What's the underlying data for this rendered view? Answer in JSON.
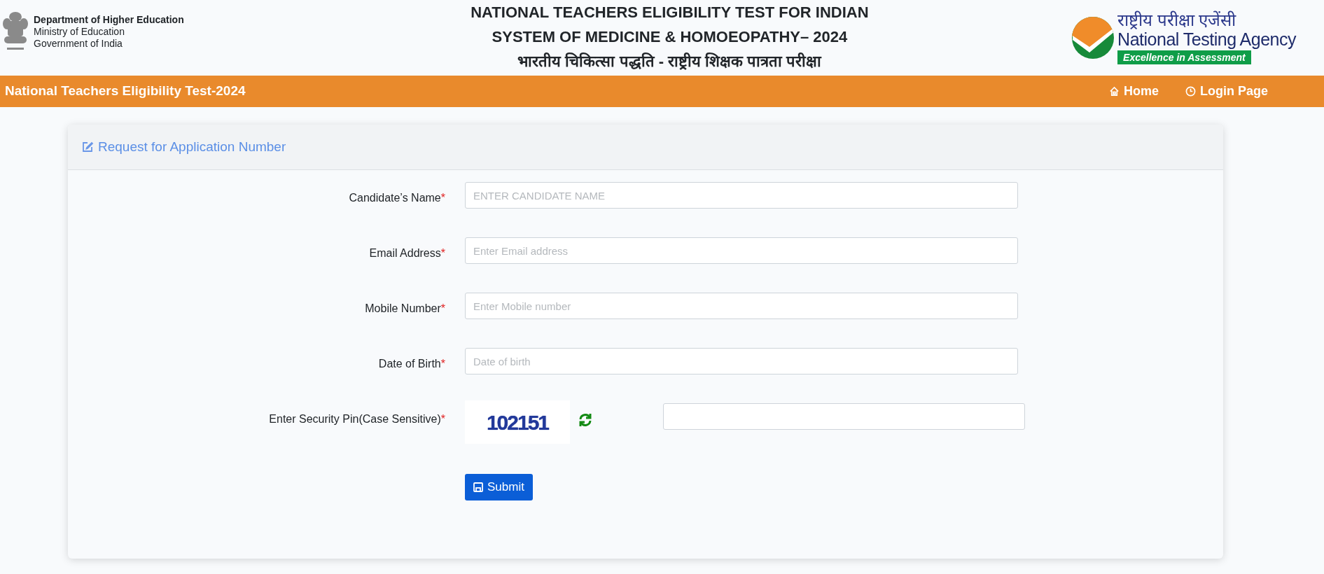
{
  "header": {
    "department": "Department of Higher Education",
    "ministry": "Ministry of Education",
    "government": "Government of India",
    "title_lines": [
      "NATIONAL TEACHERS ELIGIBILITY TEST FOR INDIAN",
      "SYSTEM OF MEDICINE & HOMOEOPATHY– 2024",
      "भारतीय चिकित्सा पद्धति - राष्ट्रीय शिक्षक पात्रता परीक्षा"
    ],
    "agency_hindi": "राष्ट्रीय परीक्षा एजेंसी",
    "agency_name": "National Testing Agency",
    "agency_tagline": "Excellence in Assessment"
  },
  "navbar": {
    "title": "National Teachers Eligibility Test-2024",
    "links": [
      {
        "label": "Home",
        "kind": "home"
      },
      {
        "label": "Login Page",
        "kind": "login"
      }
    ]
  },
  "card": {
    "title": "Request for Application Number",
    "fields": [
      {
        "label": "Candidate’s Name",
        "required_mark": "*",
        "kind": "text",
        "placeholder": "ENTER CANDIDATE NAME"
      },
      {
        "label": "Email Address",
        "required_mark": "*",
        "kind": "text",
        "placeholder": "Enter Email address"
      },
      {
        "label": "Mobile Number",
        "required_mark": "*",
        "kind": "text",
        "placeholder": "Enter Mobile number"
      },
      {
        "label": "Date of Birth",
        "required_mark": "*",
        "kind": "text",
        "placeholder": "Date of birth"
      },
      {
        "label": "Enter Security Pin(Case Sensitive)",
        "required_mark": "*",
        "kind": "captcha",
        "captcha": "102151"
      }
    ],
    "submit": "Submit"
  }
}
